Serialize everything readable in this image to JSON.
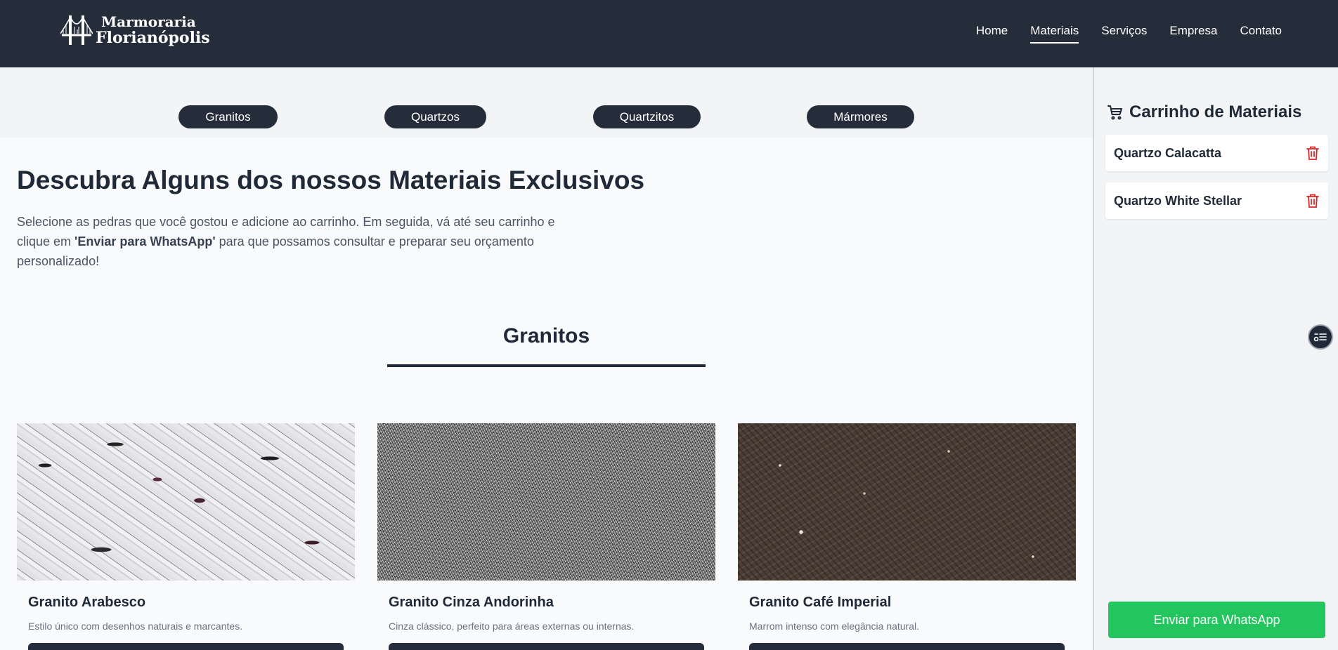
{
  "header": {
    "logo": {
      "line1": "Marmoraria",
      "line2": "Florianópolis",
      "icon": "bridge-icon"
    },
    "nav": [
      {
        "label": "Home",
        "active": false
      },
      {
        "label": "Materiais",
        "active": true
      },
      {
        "label": "Serviços",
        "active": false
      },
      {
        "label": "Empresa",
        "active": false
      },
      {
        "label": "Contato",
        "active": false
      }
    ]
  },
  "categories": [
    "Granitos",
    "Quartzos",
    "Quartzitos",
    "Mármores"
  ],
  "main": {
    "title": "Descubra Alguns dos nossos Materiais Exclusivos",
    "intro": {
      "before": "Selecione as pedras que você gostou e adicione ao carrinho. Em seguida, vá até seu carrinho e clique em ",
      "highlight": "'Enviar para WhatsApp'",
      "after": " para que possamos consultar e preparar seu orçamento personalizado!"
    },
    "section_title": "Granitos",
    "products": [
      {
        "name": "Granito Arabesco",
        "description": "Estilo único com desenhos naturais e marcantes."
      },
      {
        "name": "Granito Cinza Andorinha",
        "description": "Cinza clássico, perfeito para áreas externas ou internas."
      },
      {
        "name": "Granito Café Imperial",
        "description": "Marrom intenso com elegância natural."
      }
    ]
  },
  "cart": {
    "title": "Carrinho de Materiais",
    "icon": "cart-icon",
    "items": [
      {
        "label": "Quartzo Calacatta"
      },
      {
        "label": "Quartzo White Stellar"
      }
    ],
    "send_label": "Enviar para WhatsApp"
  },
  "colors": {
    "header_bg": "#252d3b",
    "accent_green": "#22c55e",
    "delete_red": "#dc2626"
  }
}
